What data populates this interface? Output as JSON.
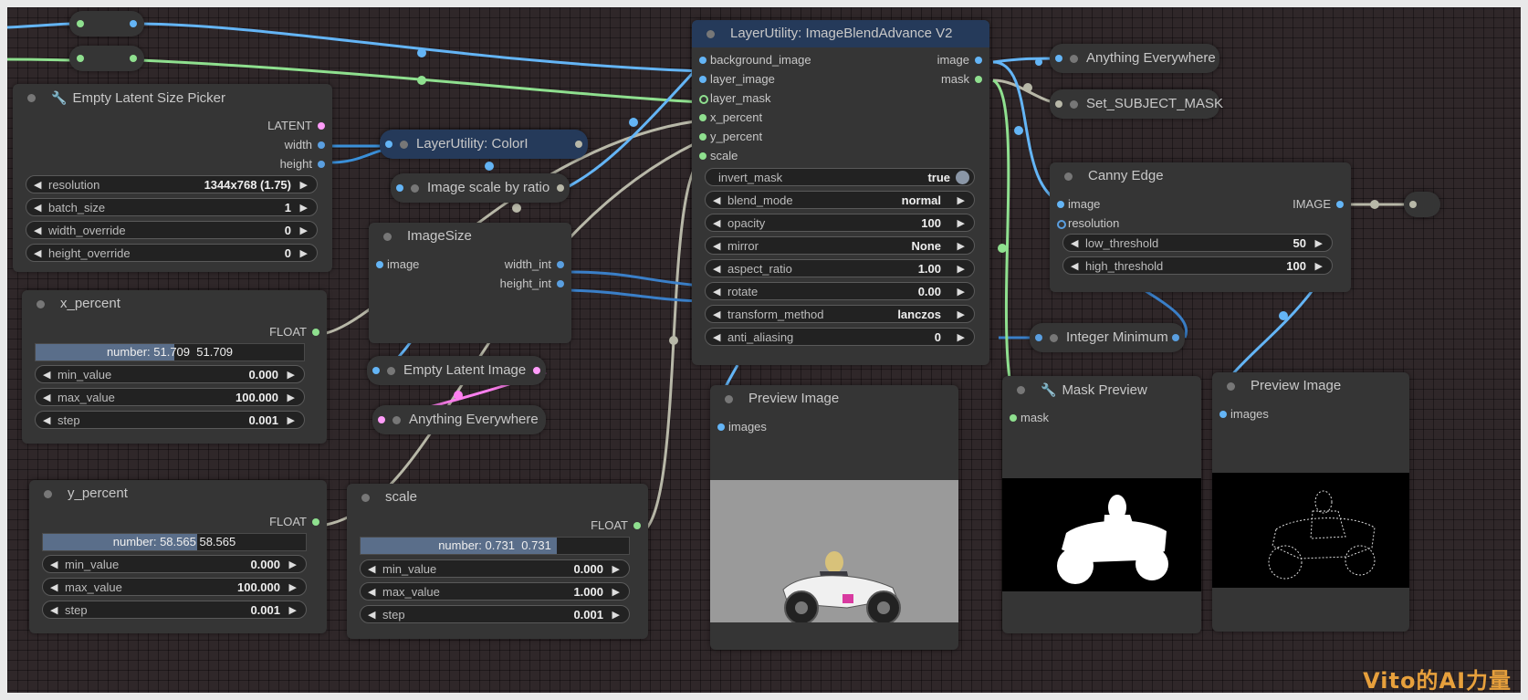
{
  "nodes": {
    "reroute1": {},
    "empty_latent_size_picker": {
      "title": "Empty Latent Size Picker",
      "outputs": [
        "LATENT",
        "width",
        "height"
      ],
      "widgets": [
        {
          "label": "resolution",
          "value": "1344x768 (1.75)"
        },
        {
          "label": "batch_size",
          "value": "1"
        },
        {
          "label": "width_override",
          "value": "0"
        },
        {
          "label": "height_override",
          "value": "0"
        }
      ]
    },
    "colorl": {
      "title": "LayerUtility: ColorI"
    },
    "image_scale_by_ratio": {
      "title": "Image scale by ratio"
    },
    "image_size": {
      "title": "ImageSize",
      "input": "image",
      "outputs": [
        "width_int",
        "height_int"
      ]
    },
    "empty_latent_image": {
      "title": "Empty Latent Image"
    },
    "anything_everywhere_left": {
      "title": "Anything Everywhere"
    },
    "x_percent": {
      "title": "x_percent",
      "output": "FLOAT",
      "number": "number: 51.709",
      "number_edit": "51.709",
      "fill_fraction": 0.517,
      "widgets": [
        {
          "label": "min_value",
          "value": "0.000"
        },
        {
          "label": "max_value",
          "value": "100.000"
        },
        {
          "label": "step",
          "value": "0.001"
        }
      ]
    },
    "y_percent": {
      "title": "y_percent",
      "output": "FLOAT",
      "number": "number: 58.565",
      "number_edit": "58.565",
      "fill_fraction": 0.586,
      "widgets": [
        {
          "label": "min_value",
          "value": "0.000"
        },
        {
          "label": "max_value",
          "value": "100.000"
        },
        {
          "label": "step",
          "value": "0.001"
        }
      ]
    },
    "scale": {
      "title": "scale",
      "output": "FLOAT",
      "number": "number: 0.731",
      "number_edit": "0.731",
      "fill_fraction": 0.731,
      "widgets": [
        {
          "label": "min_value",
          "value": "0.000"
        },
        {
          "label": "max_value",
          "value": "1.000"
        },
        {
          "label": "step",
          "value": "0.001"
        }
      ]
    },
    "blend": {
      "title": "LayerUtility: ImageBlendAdvance V2",
      "inputs": [
        "background_image",
        "layer_image",
        "layer_mask",
        "x_percent",
        "y_percent",
        "scale"
      ],
      "outputs": [
        "image",
        "mask"
      ],
      "invert_mask": {
        "label": "invert_mask",
        "value": "true"
      },
      "widgets": [
        {
          "label": "blend_mode",
          "value": "normal"
        },
        {
          "label": "opacity",
          "value": "100"
        },
        {
          "label": "mirror",
          "value": "None"
        },
        {
          "label": "aspect_ratio",
          "value": "1.00"
        },
        {
          "label": "rotate",
          "value": "0.00"
        },
        {
          "label": "transform_method",
          "value": "lanczos"
        },
        {
          "label": "anti_aliasing",
          "value": "0"
        }
      ]
    },
    "anything_everywhere_right": {
      "title": "Anything Everywhere"
    },
    "set_subject_mask": {
      "title": "Set_SUBJECT_MASK"
    },
    "canny_edge": {
      "title": "Canny Edge",
      "inputs": [
        "image",
        "resolution"
      ],
      "output": "IMAGE",
      "widgets": [
        {
          "label": "low_threshold",
          "value": "50"
        },
        {
          "label": "high_threshold",
          "value": "100"
        }
      ]
    },
    "integer_minimum": {
      "title": "Integer Minimum"
    },
    "preview_image_1": {
      "title": "Preview Image",
      "input": "images"
    },
    "mask_preview": {
      "title": "Mask Preview",
      "input": "mask"
    },
    "preview_image_2": {
      "title": "Preview Image",
      "input": "images"
    }
  },
  "watermark": "Vito的AI力量",
  "colors": {
    "canvas": "#2f2729",
    "node": "#353535",
    "title_blue": "#253a5a",
    "wire_blue": "#64b5f6",
    "wire_green": "#8fe08f",
    "wire_gray": "#b8b8a8",
    "wire_pink": "#ff80f0"
  }
}
